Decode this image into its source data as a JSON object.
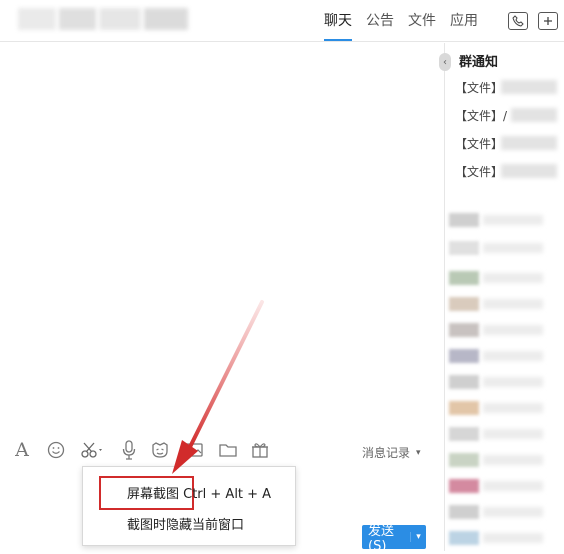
{
  "tabs": {
    "chat": "聊天",
    "notice": "公告",
    "file": "文件",
    "app": "应用"
  },
  "sidebar": {
    "notice_title": "群通知",
    "notice_items": [
      "【文件】",
      "【文件】/",
      "【文件】",
      "【文件】"
    ]
  },
  "toolbar": {
    "font_icon_label": "A",
    "history_label": "消息记录",
    "history_arrow": "▾"
  },
  "screenshot_menu": {
    "item_screen_capture": "屏幕截图 Ctrl + Alt + A",
    "item_hide_window": "截图时隐藏当前窗口"
  },
  "send": {
    "label": "发送(S)",
    "arrow": "▾"
  },
  "colors": {
    "accent": "#2b8de4",
    "highlight_red": "#d12b2b"
  }
}
